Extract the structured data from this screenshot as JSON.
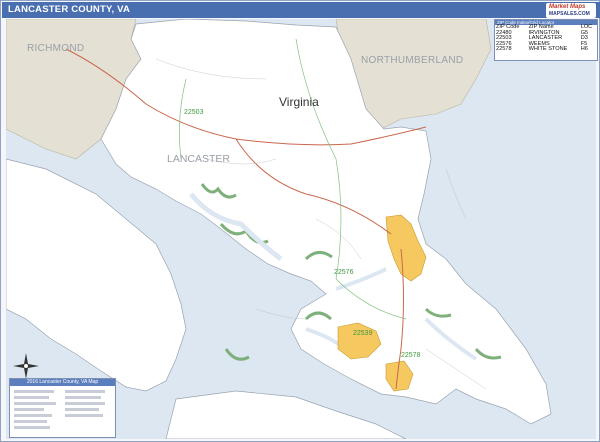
{
  "title": "LANCASTER COUNTY, VA",
  "brand": {
    "line1": "Market Maps",
    "line2": "MAPSALES.COM"
  },
  "labels": {
    "richmond": "RICHMOND",
    "northumberland": "NORTHUMBERLAND",
    "virginia": "Virginia",
    "lancaster": "LANCASTER"
  },
  "zip_labels": [
    "22503",
    "22576",
    "22539",
    "22578"
  ],
  "zip_table": {
    "header": "ZIP Code Index/Grid Locator",
    "columns": [
      "ZIP Code",
      "ZIP Name",
      "LOC"
    ],
    "rows": [
      [
        "22480",
        "IRVINGTON",
        "G5"
      ],
      [
        "22503",
        "LANCASTER",
        "D3"
      ],
      [
        "22576",
        "WEEMS",
        "F5"
      ],
      [
        "22578",
        "WHITE STONE",
        "H6"
      ]
    ]
  },
  "key_box": {
    "title": "2016 Lancaster County, VA Map"
  },
  "colors": {
    "water": "#dce7f2",
    "land": "#ffffff",
    "neighbor": "#e4e1d4",
    "town": "#f5c860",
    "road": "#c9684e",
    "park": "#7fb07b"
  }
}
